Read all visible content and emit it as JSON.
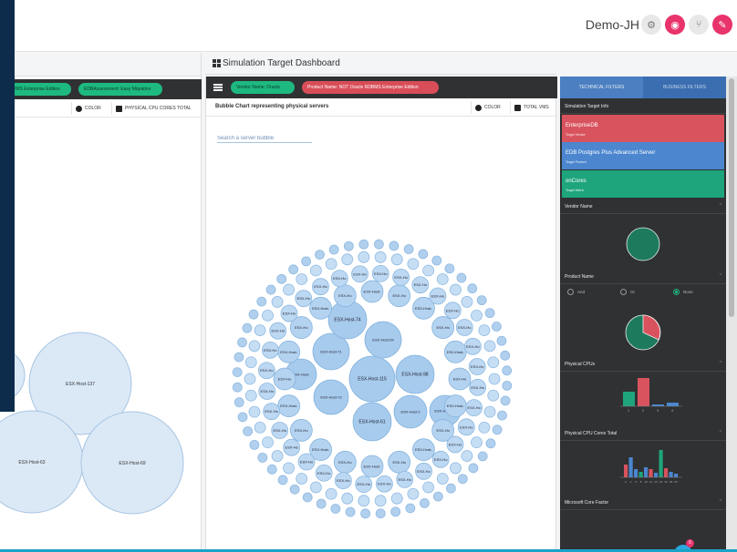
{
  "header": {
    "user_name": "Demo-JH",
    "icons": [
      "gear-icon",
      "palette-icon",
      "branch-icon",
      "edit-icon"
    ]
  },
  "left_panel": {
    "chips": [
      {
        "label": "VMS Enterprise Edition",
        "color": "#1eb980"
      },
      {
        "label": "EDBAssessment: Easy Migration",
        "color": "#1eb980"
      }
    ],
    "toolbar": {
      "color_label": "COLOR",
      "metric_label": "PHYSICAL CPU CORES TOTAL"
    },
    "bubbles": [
      "ESX-Host-137",
      "ESX-Host-63",
      "ESX-Host-69"
    ]
  },
  "center_panel": {
    "title": "Simulation Target Dashboard",
    "chips": [
      {
        "label": "Vendor Name: Oracle",
        "color": "#1eb980"
      },
      {
        "label": "Product Name: NOT Oracle RDBMS Enterprise Edition",
        "color": "#d84d57"
      }
    ],
    "chart_title": "Bubble Chart representing physical servers",
    "toolbar": {
      "color_label": "COLOR",
      "metric_label": "TOTAL VMS"
    },
    "search_placeholder": "Search a server bubble",
    "bubble_labels": {
      "big": [
        "ESX-Host-115",
        "ESX-Host-71",
        "ESX-Host-54",
        "ESX-Host-74",
        "ESX-Host-98",
        "ESX-Host-72",
        "ESX-Host-61",
        "ESX-Host-2",
        "ESX-Host-12"
      ],
      "medium": [
        "ESX-Host-",
        "ESX-Ho",
        "ESX-Ho"
      ],
      "small": "ESX-Ho"
    }
  },
  "right_panel": {
    "tabs": [
      "TECHNICAL FILTERS",
      "BUSINESS FILTERS"
    ],
    "sections": {
      "target_info": "Simulation Target Info",
      "vendor_name": "Vendor Name",
      "product_name": "Product Name",
      "physical_cpus": "Physical CPUs",
      "physical_cpu_cores_total": "Physical CPU Cores Total",
      "microsoft_core_factor": "Microsoft Core Factor"
    },
    "target_cards": [
      {
        "title": "EnterpriseDB",
        "subtitle": "Target Vendor",
        "color": "#d8535e"
      },
      {
        "title": "EDB Postgres Plus Advanced Server",
        "subtitle": "Target Product",
        "color": "#4b86cf"
      },
      {
        "title": "onCores",
        "subtitle": "Target Metric",
        "color": "#1ea57c"
      }
    ],
    "radio_options": [
      {
        "label": "And",
        "selected": false
      },
      {
        "label": "Or",
        "selected": false
      },
      {
        "label": "None",
        "selected": true
      }
    ],
    "cpu_chart_ticks": [
      "1",
      "2",
      "3",
      "4"
    ],
    "cores_chart_ticks": [
      "2",
      "4",
      "6",
      "8",
      "10",
      "12",
      "16",
      "24",
      "32",
      "48",
      "64"
    ]
  },
  "fab_badge": "0"
}
